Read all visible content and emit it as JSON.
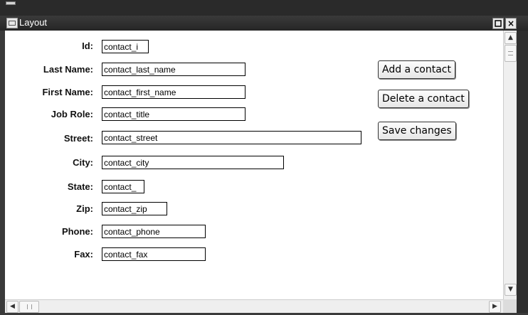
{
  "window": {
    "title": "Layout",
    "restore_icon": "restore-icon",
    "close_glyph": "×"
  },
  "form": {
    "fields": [
      {
        "label": "Id:",
        "value": "contact_i"
      },
      {
        "label": "Last Name:",
        "value": "contact_last_name"
      },
      {
        "label": "First Name:",
        "value": "contact_first_name"
      },
      {
        "label": "Job Role:",
        "value": "contact_title"
      },
      {
        "label": "Street:",
        "value": "contact_street"
      },
      {
        "label": "City:",
        "value": "contact_city"
      },
      {
        "label": "State:",
        "value": "contact_"
      },
      {
        "label": "Zip:",
        "value": "contact_zip"
      },
      {
        "label": "Phone:",
        "value": "contact_phone"
      },
      {
        "label": "Fax:",
        "value": "contact_fax"
      }
    ]
  },
  "actions": {
    "add": "Add a contact",
    "delete": "Delete a contact",
    "save": "Save changes"
  },
  "scroll": {
    "up": "▲",
    "down": "▼",
    "left": "◀",
    "right": "▶"
  }
}
